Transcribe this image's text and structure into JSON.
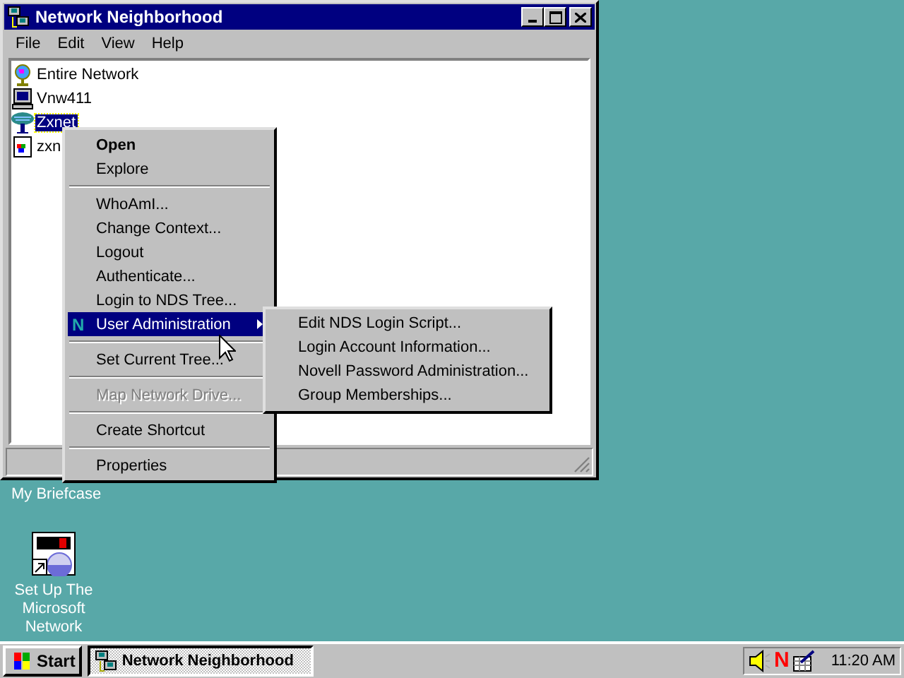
{
  "window": {
    "title": "Network Neighborhood",
    "menu": [
      "File",
      "Edit",
      "View",
      "Help"
    ],
    "items": [
      {
        "label": "Entire Network",
        "kind": "globe",
        "selected": false
      },
      {
        "label": "Vnw411",
        "kind": "computer",
        "selected": false
      },
      {
        "label": "Zxnet",
        "kind": "tree",
        "selected": true
      },
      {
        "label": "zxn",
        "kind": "document",
        "selected": false
      }
    ]
  },
  "context_menu": {
    "items": [
      {
        "kind": "item",
        "label": "Open",
        "default": true,
        "disabled": false,
        "selected": false
      },
      {
        "kind": "item",
        "label": "Explore",
        "default": false,
        "disabled": false,
        "selected": false
      },
      {
        "kind": "separator"
      },
      {
        "kind": "item",
        "label": "WhoAmI...",
        "default": false,
        "disabled": false,
        "selected": false
      },
      {
        "kind": "item",
        "label": "Change Context...",
        "default": false,
        "disabled": false,
        "selected": false
      },
      {
        "kind": "item",
        "label": "Logout",
        "default": false,
        "disabled": false,
        "selected": false
      },
      {
        "kind": "item",
        "label": "Authenticate...",
        "default": false,
        "disabled": false,
        "selected": false
      },
      {
        "kind": "item",
        "label": "Login to NDS Tree...",
        "default": false,
        "disabled": false,
        "selected": false
      },
      {
        "kind": "item",
        "label": "User Administration",
        "icon": "N",
        "submenu": true,
        "default": false,
        "disabled": false,
        "selected": true
      },
      {
        "kind": "separator"
      },
      {
        "kind": "item",
        "label": "Set Current Tree...",
        "default": false,
        "disabled": false,
        "selected": false
      },
      {
        "kind": "separator"
      },
      {
        "kind": "item",
        "label": "Map Network Drive...",
        "default": false,
        "disabled": true,
        "selected": false
      },
      {
        "kind": "separator"
      },
      {
        "kind": "item",
        "label": "Create Shortcut",
        "default": false,
        "disabled": false,
        "selected": false
      },
      {
        "kind": "separator"
      },
      {
        "kind": "item",
        "label": "Properties",
        "default": false,
        "disabled": false,
        "selected": false
      }
    ]
  },
  "submenu": {
    "items": [
      "Edit NDS Login Script...",
      "Login Account Information...",
      "Novell Password Administration...",
      "Group Memberships..."
    ]
  },
  "desktop_icons": [
    {
      "label": "My Briefcase",
      "kind": "briefcase"
    },
    {
      "label": "Set Up The Microsoft Network",
      "kind": "msn"
    }
  ],
  "taskbar": {
    "start": "Start",
    "tasks": [
      {
        "label": "Network Neighborhood",
        "selected": true
      }
    ],
    "tray_letter": "N",
    "clock": "11:20 AM"
  }
}
